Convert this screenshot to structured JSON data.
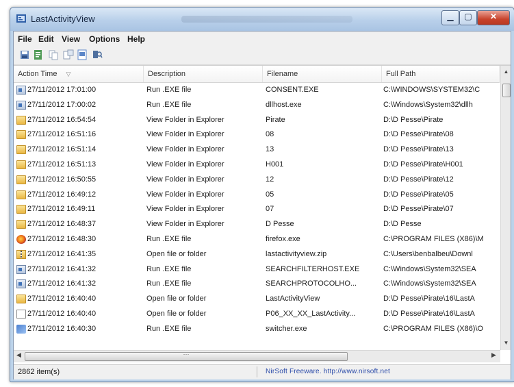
{
  "window": {
    "title": "LastActivityView"
  },
  "menu": [
    "File",
    "Edit",
    "View",
    "Options",
    "Help"
  ],
  "toolbar": [
    {
      "name": "save-icon",
      "color": "#6a8bbf"
    },
    {
      "name": "export-icon",
      "color": "#4f9a56"
    },
    {
      "name": "copy-icon",
      "color": "#9aa8bc"
    },
    {
      "name": "properties-icon",
      "color": "#8e9cb4"
    },
    {
      "name": "html-report-icon",
      "color": "#5b86c8"
    },
    {
      "name": "find-icon",
      "color": "#4e6f9e"
    }
  ],
  "columns": [
    "Action Time",
    "Description",
    "Filename",
    "Full Path"
  ],
  "rows": [
    {
      "icon": "exe",
      "time": "27/11/2012 17:01:00",
      "desc": "Run .EXE file",
      "file": "CONSENT.EXE",
      "path": "C:\\WINDOWS\\SYSTEM32\\C"
    },
    {
      "icon": "exe",
      "time": "27/11/2012 17:00:02",
      "desc": "Run .EXE file",
      "file": "dllhost.exe",
      "path": "C:\\Windows\\System32\\dllh"
    },
    {
      "icon": "folder",
      "time": "27/11/2012 16:54:54",
      "desc": "View Folder in Explorer",
      "file": "Pirate",
      "path": "D:\\D Pesse\\Pirate"
    },
    {
      "icon": "folder",
      "time": "27/11/2012 16:51:16",
      "desc": "View Folder in Explorer",
      "file": "08",
      "path": "D:\\D Pesse\\Pirate\\08"
    },
    {
      "icon": "folder",
      "time": "27/11/2012 16:51:14",
      "desc": "View Folder in Explorer",
      "file": "13",
      "path": "D:\\D Pesse\\Pirate\\13"
    },
    {
      "icon": "folder",
      "time": "27/11/2012 16:51:13",
      "desc": "View Folder in Explorer",
      "file": "H001",
      "path": "D:\\D Pesse\\Pirate\\H001"
    },
    {
      "icon": "folder",
      "time": "27/11/2012 16:50:55",
      "desc": "View Folder in Explorer",
      "file": "12",
      "path": "D:\\D Pesse\\Pirate\\12"
    },
    {
      "icon": "folder",
      "time": "27/11/2012 16:49:12",
      "desc": "View Folder in Explorer",
      "file": "05",
      "path": "D:\\D Pesse\\Pirate\\05"
    },
    {
      "icon": "folder",
      "time": "27/11/2012 16:49:11",
      "desc": "View Folder in Explorer",
      "file": "07",
      "path": "D:\\D Pesse\\Pirate\\07"
    },
    {
      "icon": "folder",
      "time": "27/11/2012 16:48:37",
      "desc": "View Folder in Explorer",
      "file": "D Pesse",
      "path": "D:\\D Pesse"
    },
    {
      "icon": "firefox",
      "time": "27/11/2012 16:48:30",
      "desc": "Run .EXE file",
      "file": "firefox.exe",
      "path": "C:\\PROGRAM FILES (X86)\\M"
    },
    {
      "icon": "zip",
      "time": "27/11/2012 16:41:35",
      "desc": "Open file or folder",
      "file": "lastactivityview.zip",
      "path": "C:\\Users\\benbalbeu\\Downl"
    },
    {
      "icon": "exe",
      "time": "27/11/2012 16:41:32",
      "desc": "Run .EXE file",
      "file": "SEARCHFILTERHOST.EXE",
      "path": "C:\\Windows\\System32\\SEA"
    },
    {
      "icon": "exe",
      "time": "27/11/2012 16:41:32",
      "desc": "Run .EXE file",
      "file": "SEARCHPROTOCOLHO...",
      "path": "C:\\Windows\\System32\\SEA"
    },
    {
      "icon": "folder",
      "time": "27/11/2012 16:40:40",
      "desc": "Open file or folder",
      "file": "LastActivityView",
      "path": "D:\\D Pesse\\Pirate\\16\\LastA"
    },
    {
      "icon": "file",
      "time": "27/11/2012 16:40:40",
      "desc": "Open file or folder",
      "file": "P06_XX_XX_LastActivity...",
      "path": "D:\\D Pesse\\Pirate\\16\\LastA"
    },
    {
      "icon": "switch",
      "time": "27/11/2012 16:40:30",
      "desc": "Run .EXE file",
      "file": "switcher.exe",
      "path": "C:\\PROGRAM FILES (X86)\\O"
    }
  ],
  "status": {
    "items": "2862 item(s)",
    "link": "NirSoft Freeware.  http://www.nirsoft.net"
  }
}
